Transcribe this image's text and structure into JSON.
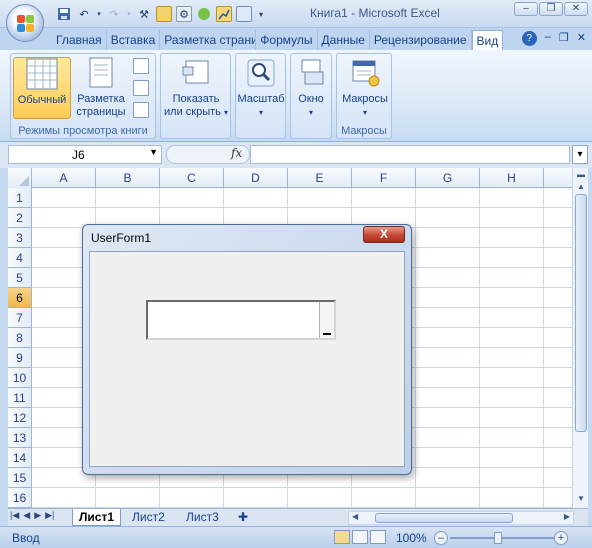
{
  "window": {
    "title": "Книга1 - Microsoft Excel"
  },
  "tabs": [
    "Главная",
    "Вставка",
    "Разметка страницы",
    "Формулы",
    "Данные",
    "Рецензирование",
    "Вид"
  ],
  "active_tab": "Вид",
  "ribbon": {
    "workbook_views": {
      "label": "Режимы просмотра книги",
      "normal": "Обычный",
      "page_layout_1": "Разметка",
      "page_layout_2": "страницы"
    },
    "show_hide": {
      "line1": "Показать",
      "line2": "или скрыть"
    },
    "zoom": {
      "label": "Масштаб"
    },
    "window": {
      "label": "Окно"
    },
    "macros": {
      "button": "Макросы",
      "label": "Макросы"
    }
  },
  "formula_bar": {
    "name_box": "J6",
    "fx": "fx",
    "formula": ""
  },
  "grid": {
    "columns": [
      "A",
      "B",
      "C",
      "D",
      "E",
      "F",
      "G",
      "H"
    ],
    "rows": [
      "1",
      "2",
      "3",
      "4",
      "5",
      "6",
      "7",
      "8",
      "9",
      "10",
      "11",
      "12",
      "13",
      "14",
      "15",
      "16"
    ],
    "selected_row": "6"
  },
  "sheets": {
    "tabs": [
      "Лист1",
      "Лист2",
      "Лист3"
    ],
    "active": "Лист1"
  },
  "status_bar": {
    "status": "Ввод",
    "zoom": "100%"
  },
  "userform": {
    "title": "UserForm1",
    "close": "X",
    "textbox_value": ""
  },
  "colors": {
    "accent": "#15428b",
    "selected_header": "#f1b94b",
    "close_button": "#c54836"
  }
}
